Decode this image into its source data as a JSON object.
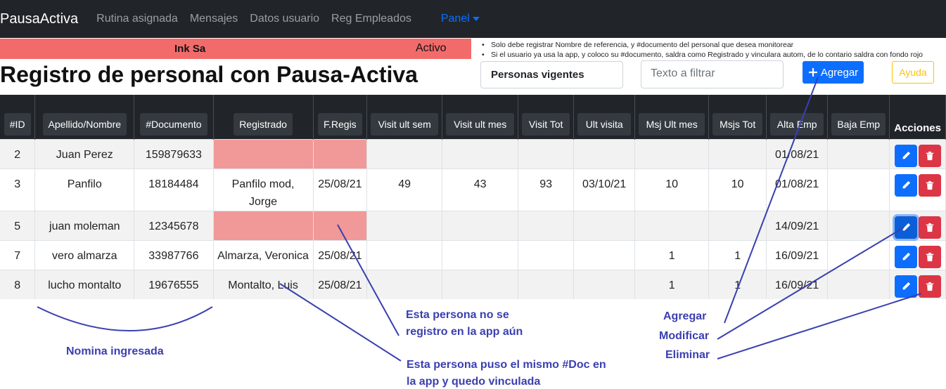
{
  "navbar": {
    "brand": "PausaActiva",
    "links": [
      "Rutina asignada",
      "Mensajes",
      "Datos usuario",
      "Reg Empleados"
    ],
    "panel": "Panel"
  },
  "company_bar": {
    "company": "Ink Sa",
    "status": "Activo",
    "color": "#f26b6b"
  },
  "notes": [
    "Solo debe registrar Nombre de referencia, y #documento del personal que desea monitorear",
    "Si el usuario ya usa la app, y coloco su #documento, saldra como  Registrado  y vinculara autom, de lo contario saldra con fondo rojo"
  ],
  "title": "Registro de personal con Pausa-Activa",
  "toolbar": {
    "select_value": "Personas vigentes",
    "filter_placeholder": "Texto a filtrar",
    "add_label": "Agregar",
    "help_label": "Ayuda"
  },
  "table": {
    "headers": [
      "#ID",
      "Apellido/Nombre",
      "#Documento",
      "Registrado",
      "F.Regis",
      "Visit ult sem",
      "Visit ult mes",
      "Visit Tot",
      "Ult visita",
      "Msj Ult mes",
      "Msjs Tot",
      "Alta Emp",
      "Baja Emp",
      "Acciones"
    ],
    "rows": [
      {
        "id": "2",
        "name": "Juan Perez",
        "doc": "159879633",
        "reg": "",
        "freg": "",
        "vsem": "",
        "vmes": "",
        "vtot": "",
        "ult": "",
        "msjmes": "",
        "msjtot": "",
        "alta": "01/08/21",
        "baja": "",
        "unregistered": true
      },
      {
        "id": "3",
        "name": "Panfilo",
        "doc": "18184484",
        "reg": "Panfilo mod, Jorge",
        "freg": "25/08/21",
        "vsem": "49",
        "vmes": "43",
        "vtot": "93",
        "ult": "03/10/21",
        "msjmes": "10",
        "msjtot": "10",
        "alta": "01/08/21",
        "baja": "",
        "unregistered": false
      },
      {
        "id": "5",
        "name": "juan moleman",
        "doc": "12345678",
        "reg": "",
        "freg": "",
        "vsem": "",
        "vmes": "",
        "vtot": "",
        "ult": "",
        "msjmes": "",
        "msjtot": "",
        "alta": "14/09/21",
        "baja": "",
        "unregistered": true
      },
      {
        "id": "7",
        "name": "vero almarza",
        "doc": "33987766",
        "reg": "Almarza, Veronica",
        "freg": "25/08/21",
        "vsem": "",
        "vmes": "",
        "vtot": "",
        "ult": "",
        "msjmes": "1",
        "msjtot": "1",
        "alta": "16/09/21",
        "baja": "",
        "unregistered": false
      },
      {
        "id": "8",
        "name": "lucho montalto",
        "doc": "19676555",
        "reg": "Montalto, Luis",
        "freg": "25/08/21",
        "vsem": "",
        "vmes": "",
        "vtot": "",
        "ult": "",
        "msjmes": "1",
        "msjtot": "1",
        "alta": "16/09/21",
        "baja": "",
        "unregistered": false
      }
    ]
  },
  "annotations": {
    "nomina": "Nomina ingresada",
    "no_registro": "Esta persona no se registro en la app aún",
    "vinculada": "Esta persona puso el mismo #Doc en la app y quedo vinculada",
    "agregar": "Agregar",
    "modificar": "Modificar",
    "eliminar": "Eliminar",
    "color": "#3a3fb0"
  },
  "icons": {
    "edit": "pencil-icon",
    "delete": "trash-icon",
    "add": "plus-icon"
  }
}
